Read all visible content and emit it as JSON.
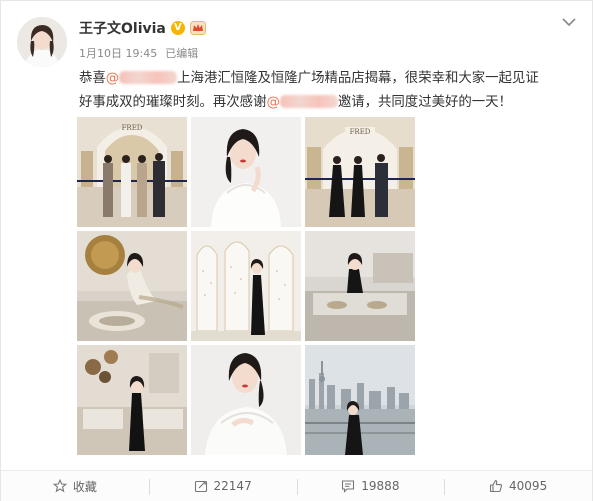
{
  "header": {
    "username": "王子文Olivia",
    "verified_badge": "V",
    "date": "1月10日 19:45",
    "edited": "已编辑"
  },
  "post": {
    "line1_prefix": "恭喜",
    "line1_main": "上海港汇恒隆及恒隆广场精品店揭幕，很荣幸和大家一起见证",
    "line2_prefix": "好事成双的璀璨时刻。再次感谢",
    "line2_suffix": "邀请，共同度过美好的一天！",
    "at_symbol": "@"
  },
  "images": {
    "store_sign": "FRED",
    "photos": [
      {
        "scene": "ribbon-cutting-white-store"
      },
      {
        "scene": "portrait-white-dress"
      },
      {
        "scene": "ribbon-cutting-black-dresses"
      },
      {
        "scene": "seated-at-display-case"
      },
      {
        "scene": "standing-arched-backdrop"
      },
      {
        "scene": "leaning-on-display-case"
      },
      {
        "scene": "standing-in-boutique"
      },
      {
        "scene": "portrait-white-dress-2"
      },
      {
        "scene": "city-skyline-balcony"
      }
    ]
  },
  "actions": {
    "favorite_label": "收藏",
    "repost_count": "22147",
    "comment_count": "19888",
    "like_count": "40095"
  },
  "colors": {
    "mention": "#eb7350",
    "verified": "#f7b500",
    "text": "#333333",
    "muted": "#8a8a8a"
  }
}
